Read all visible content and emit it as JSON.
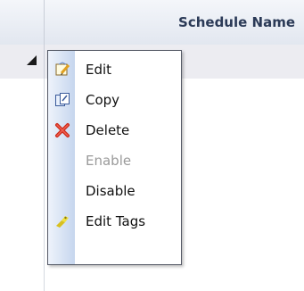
{
  "grid": {
    "column_header": "Schedule Name"
  },
  "context_menu": {
    "items": [
      {
        "label": "Edit",
        "icon": "edit-icon",
        "enabled": true
      },
      {
        "label": "Copy",
        "icon": "copy-icon",
        "enabled": true
      },
      {
        "label": "Delete",
        "icon": "delete-icon",
        "enabled": true
      },
      {
        "label": "Enable",
        "icon": "",
        "enabled": false
      },
      {
        "label": "Disable",
        "icon": "",
        "enabled": true
      },
      {
        "label": "Edit Tags",
        "icon": "edit-tags-icon",
        "enabled": true
      }
    ]
  },
  "colors": {
    "header_text": "#2b3a57",
    "selected_row": "#ececf1",
    "disabled_text": "#9a9a9a",
    "delete_icon": "#cc2a1a"
  }
}
